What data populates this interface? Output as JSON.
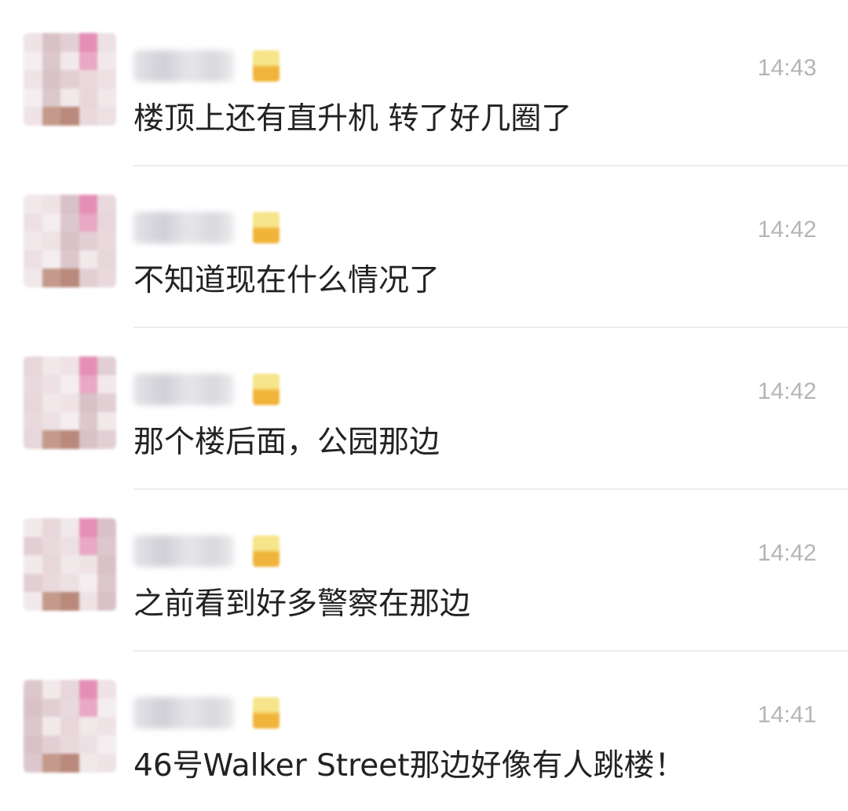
{
  "messages": [
    {
      "time": "14:43",
      "text": "楼顶上还有直升机 转了好几圈了"
    },
    {
      "time": "14:42",
      "text": "不知道现在什么情况了"
    },
    {
      "time": "14:42",
      "text": "那个楼后面，公园那边"
    },
    {
      "time": "14:42",
      "text": "之前看到好多警察在那边"
    },
    {
      "time": "14:41",
      "text": "46号Walker Street那边好像有人跳楼！"
    }
  ],
  "colors": {
    "time_text": "#b5b5b8",
    "message_text": "#222222",
    "divider": "#ededee",
    "badge_top": "#f6e58a",
    "badge_bottom": "#f0b43a"
  },
  "icons": {
    "avatar": "pixelated-avatar",
    "badge": "level-badge-icon"
  }
}
